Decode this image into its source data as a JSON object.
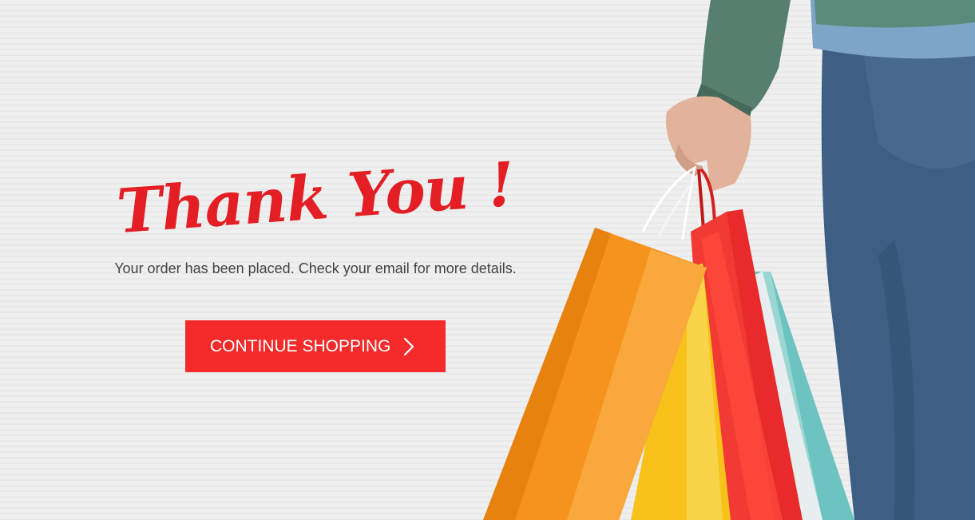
{
  "hero": {
    "title": "Thank You !",
    "message": "Your order has been placed. Check your email for more details."
  },
  "cta": {
    "label": "CONTINUE SHOPPING",
    "icon": "chevron-right-icon"
  },
  "colors": {
    "accent": "#e31e24",
    "button": "#f52b2b",
    "text": "#444444",
    "background": "#ececec"
  }
}
